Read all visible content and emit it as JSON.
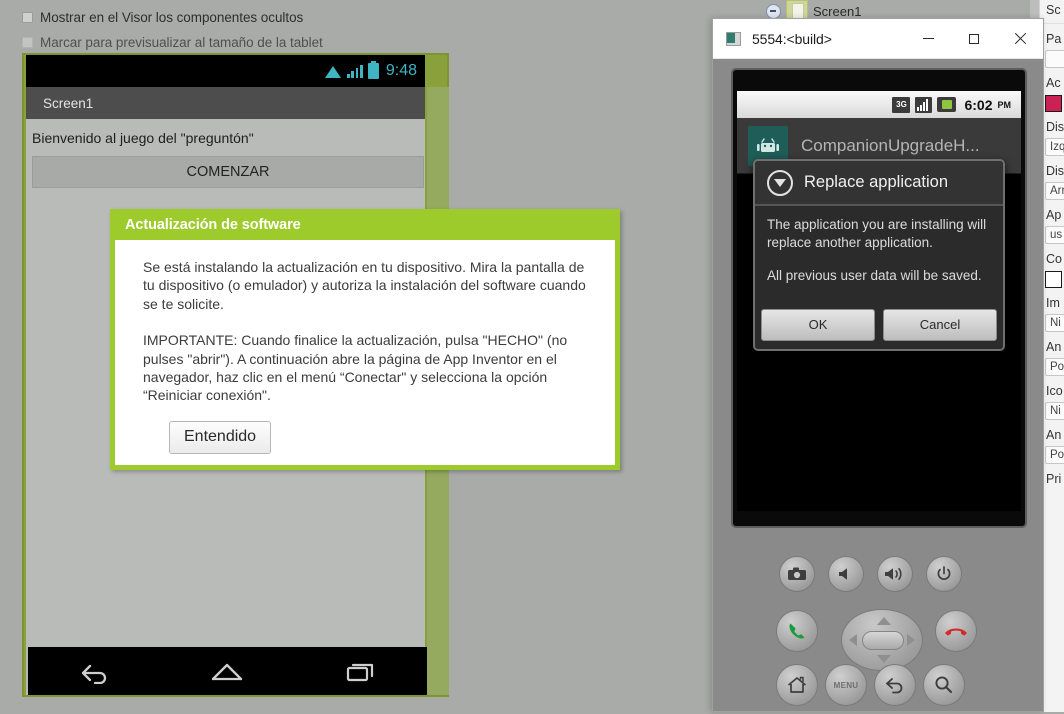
{
  "designer": {
    "options": [
      {
        "label": "Mostrar en el Visor los componentes ocultos",
        "checked": false
      },
      {
        "label": "Marcar para previsualizar al tamaño de la tablet",
        "checked": false
      }
    ],
    "tree_item": {
      "label": "Screen1"
    }
  },
  "viewer": {
    "status": {
      "time": "9:48"
    },
    "title": "Screen1",
    "welcome_label": "Bienvenido al juego del \"preguntón\"",
    "start_button": "COMENZAR",
    "nav": {
      "back": "back-icon",
      "home": "home-icon",
      "recents": "recents-icon"
    }
  },
  "software_dialog": {
    "title": "Actualización de software",
    "paragraph1": "Se está instalando la actualización en tu dispositivo. Mira la pantalla de tu dispositivo (o emulador) y autoriza la instalación del software cuando se te solicite.",
    "paragraph2": "IMPORTANTE: Cuando finalice la actualización, pulsa \"HECHO\" (no pulses \"abrir\"). A continuación abre la página de App Inventor en el navegador, haz clic en el menú “Conectar\" y selecciona la opción “Reiniciar conexión\".",
    "ok_button": "Entendido"
  },
  "emulator_window": {
    "title": "5554:<build>",
    "minimize_label": "—",
    "maximize_label": "□",
    "close_label": "✕"
  },
  "emulator_screen": {
    "status": {
      "network": "3G",
      "time": "6:02",
      "ampm": "PM"
    },
    "notification": "CompanionUpgradeH...",
    "replace_dialog": {
      "title": "Replace application",
      "paragraph1": "The application you are installing will replace another application.",
      "paragraph2": "All previous user data will be saved.",
      "ok_button": "OK",
      "cancel_button": "Cancel"
    }
  },
  "emulator_keys": {
    "camera": "camera-icon",
    "volume_down": "volume-down-icon",
    "volume_up": "volume-up-icon",
    "power": "power-icon",
    "call": "call-icon",
    "end_call": "end-call-icon",
    "home": "home-icon",
    "menu_label": "MENU",
    "back": "back-icon",
    "search": "search-icon"
  },
  "properties_sidebar": {
    "header": "Sc",
    "rows": [
      {
        "label": "Pa",
        "value": ""
      },
      {
        "label": "Ac",
        "value": "",
        "swatch": "#cc2154"
      },
      {
        "label": "Dis",
        "value": "Izq"
      },
      {
        "label": "Dis",
        "value": "Arr"
      },
      {
        "label": "Ap",
        "value": "us"
      },
      {
        "label": "Co",
        "value": "",
        "swatch": "#ffffff"
      },
      {
        "label": "Im",
        "value": "Ni"
      },
      {
        "label": "An",
        "value": "Po"
      },
      {
        "label": "Ico",
        "value": "Ni"
      },
      {
        "label": "An",
        "value": "Po"
      },
      {
        "label": "Pri",
        "value": ""
      }
    ]
  },
  "colors": {
    "page_background": "#a9aba9",
    "appinventor_green": "#9ccb2b",
    "viewer_frame_green": "#8aa03b",
    "viewer_band_green": "#95a95f",
    "android_teal": "#3fb5c4",
    "accent_swatch": "#cc2154"
  }
}
